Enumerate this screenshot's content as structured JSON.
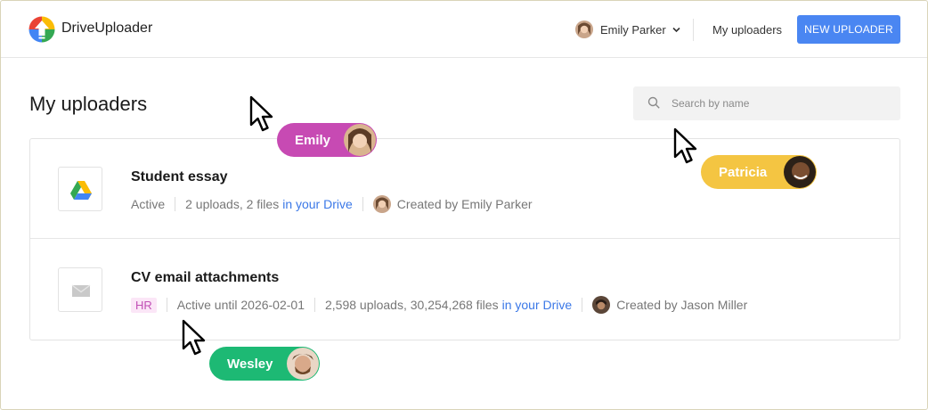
{
  "app": {
    "brand": "DriveUploader"
  },
  "header": {
    "user_name": "Emily Parker",
    "my_uploaders_link": "My uploaders",
    "new_uploader_button": "NEW UPLOADER"
  },
  "main": {
    "title": "My uploaders",
    "search": {
      "placeholder": "Search by name",
      "value": ""
    }
  },
  "uploaders": [
    {
      "title": "Student essay",
      "icon": "google-drive-icon",
      "tag": "",
      "status": "Active",
      "counts": "2 uploads, 2 files",
      "link": "in your Drive",
      "created_by": "Created by Emily Parker"
    },
    {
      "title": "CV email attachments",
      "icon": "email-envelope-icon",
      "tag": "HR",
      "status": "Active until 2026-02-01",
      "counts": "2,598 uploads, 30,254,268 files",
      "link": "in your Drive",
      "created_by": "Created by Jason Miller"
    }
  ],
  "collaborators": [
    {
      "name": "Emily",
      "color": "#c74ab3"
    },
    {
      "name": "Patricia",
      "color": "#f4c542"
    },
    {
      "name": "Wesley",
      "color": "#1db974"
    }
  ],
  "colors": {
    "accent": "#4a86f2",
    "link": "#3b78e7",
    "tag_bg": "#fbe6f7",
    "tag_fg": "#c14fb5"
  }
}
